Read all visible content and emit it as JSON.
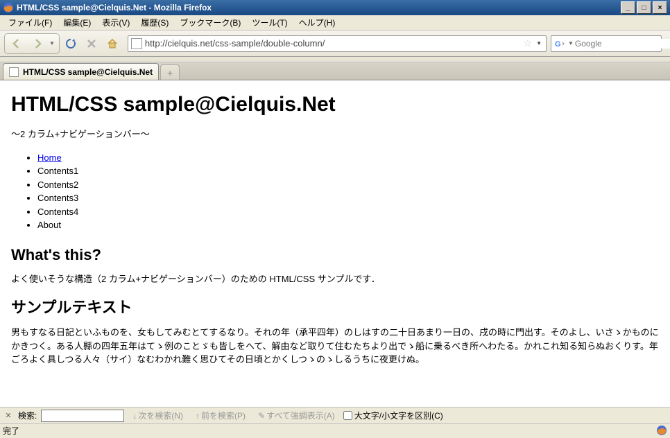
{
  "window": {
    "title": "HTML/CSS sample@Cielquis.Net - Mozilla Firefox",
    "minimize": "_",
    "maximize": "□",
    "close": "×"
  },
  "menu": {
    "file": "ファイル(F)",
    "edit": "編集(E)",
    "view": "表示(V)",
    "history": "履歴(S)",
    "bookmarks": "ブックマーク(B)",
    "tools": "ツール(T)",
    "help": "ヘルプ(H)"
  },
  "url": "http://cielquis.net/css-sample/double-column/",
  "search_placeholder": "Google",
  "tab": {
    "label": "HTML/CSS sample@Cielquis.Net",
    "newtab": "+"
  },
  "page": {
    "h1": "HTML/CSS sample@Cielquis.Net",
    "sub": "〜2 カラム+ナビゲーションバー〜",
    "nav": {
      "home": "Home",
      "c1": "Contents1",
      "c2": "Contents2",
      "c3": "Contents3",
      "c4": "Contents4",
      "about": "About"
    },
    "h2a": "What's this?",
    "p1": "よく使いそうな構造（2 カラム+ナビゲーションバー）のための HTML/CSS サンプルです．",
    "h2b": "サンプルテキスト",
    "p2": "男もすなる日記といふものを、女もしてみむとてするなり。それの年（承平四年）のしはすの二十日あまり一日の、戌の時に門出す。そのよし、いさゝかものにかきつく。ある人縣の四年五年はてゝ例のことゞも皆しをへて、解由など取りて住むたちより出でゝ船に乗るべき所へわたる。かれこれ知る知らぬおくりす。年ごろよく具しつる人々（サイ）なむわかれ難く思ひてその日頃とかくしつゝのゝしるうちに夜更けぬ。"
  },
  "findbar": {
    "label": "検索:",
    "next": "次を検索(N)",
    "prev": "前を検索(P)",
    "highlight": "すべて強調表示(A)",
    "case": "大文字/小文字を区別(C)"
  },
  "status": {
    "done": "完了"
  }
}
